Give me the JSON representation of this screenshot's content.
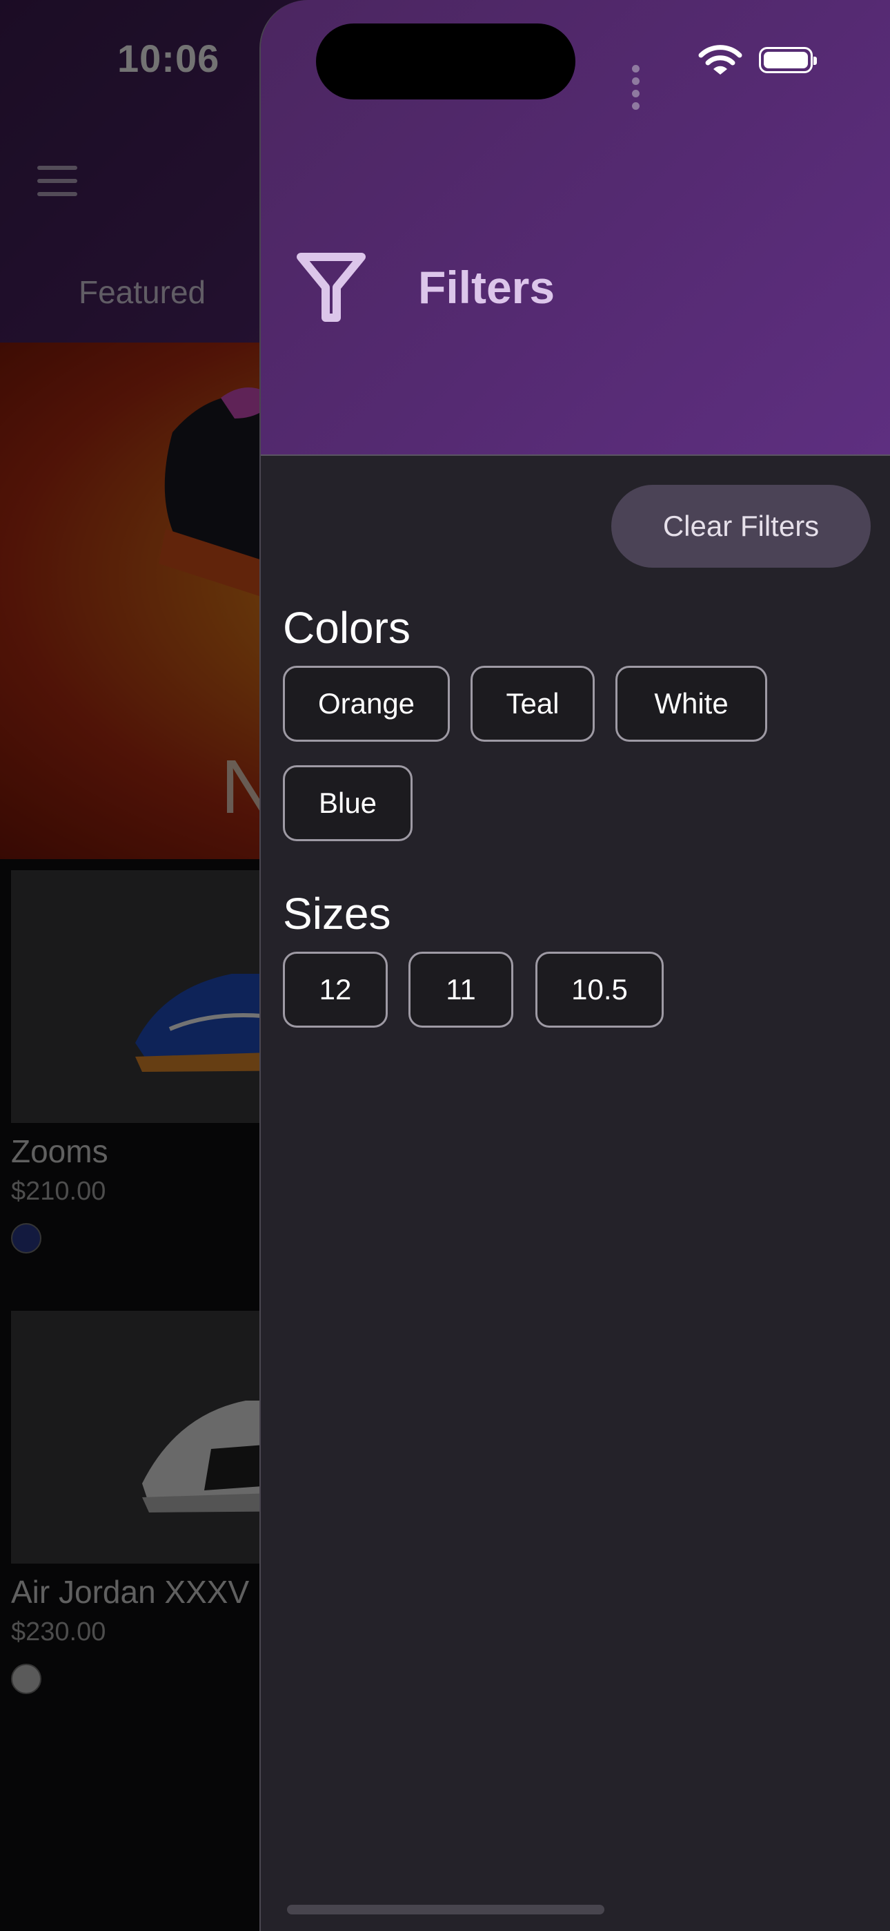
{
  "status_bar": {
    "time": "10:06"
  },
  "background": {
    "tab_label": "Featured",
    "hero_letter": "N",
    "products": [
      {
        "name": "Zooms",
        "price": "$210.00",
        "swatch_color": "#2b3a8c"
      },
      {
        "name": "Air Jordan XXXV",
        "price": "$230.00",
        "swatch_color": "#c8c8c8"
      }
    ]
  },
  "drawer": {
    "title": "Filters",
    "icon": "filter-funnel-icon",
    "clear_label": "Clear Filters",
    "colors_title": "Colors",
    "colors": [
      "Orange",
      "Teal",
      "White",
      "Blue"
    ],
    "sizes_title": "Sizes",
    "sizes": [
      "12",
      "11",
      "10.5"
    ]
  },
  "theme": {
    "accent": "#5b2b7a",
    "drawer_bg": "#242229",
    "chip_border": "#9e9aa4"
  }
}
